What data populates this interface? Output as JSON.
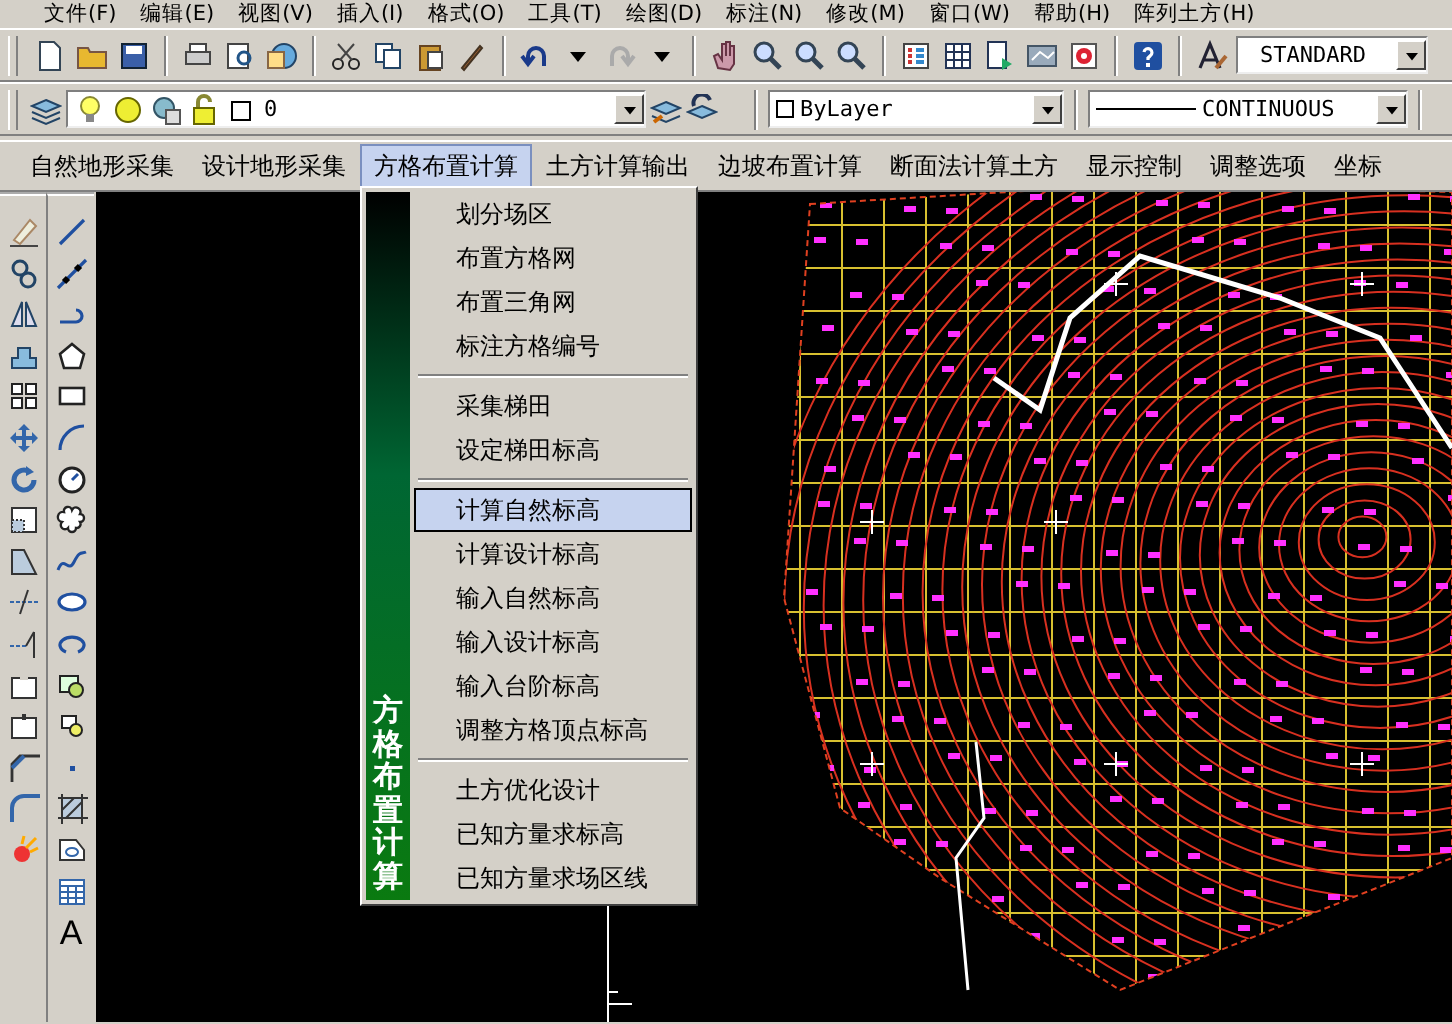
{
  "menu_bar": [
    "文件(F)",
    "编辑(E)",
    "视图(V)",
    "插入(I)",
    "格式(O)",
    "工具(T)",
    "绘图(D)",
    "标注(N)",
    "修改(M)",
    "窗口(W)",
    "帮助(H)",
    "阵列土方(H)"
  ],
  "standard_toolbar": {
    "text_style": "STANDARD"
  },
  "layers_toolbar": {
    "layer": "0"
  },
  "properties_toolbar": {
    "object_color": "ByLayer",
    "linetype": "CONTINUOUS"
  },
  "custom_menu": [
    {
      "label": "自然地形采集",
      "selected": false
    },
    {
      "label": "设计地形采集",
      "selected": false
    },
    {
      "label": "方格布置计算",
      "selected": true
    },
    {
      "label": "土方计算输出",
      "selected": false
    },
    {
      "label": "边坡布置计算",
      "selected": false
    },
    {
      "label": "断面法计算土方",
      "selected": false
    },
    {
      "label": "显示控制",
      "selected": false
    },
    {
      "label": "调整选项",
      "selected": false
    },
    {
      "label": "坐标",
      "selected": false
    }
  ],
  "dropdown": {
    "title": "方格布置计算",
    "groups": [
      [
        {
          "label": "划分场区",
          "selected": false
        },
        {
          "label": "布置方格网",
          "selected": false
        },
        {
          "label": "布置三角网",
          "selected": false
        },
        {
          "label": "标注方格编号",
          "selected": false
        }
      ],
      [
        {
          "label": "采集梯田",
          "selected": false
        },
        {
          "label": "设定梯田标高",
          "selected": false
        }
      ],
      [
        {
          "label": "计算自然标高",
          "selected": true
        },
        {
          "label": "计算设计标高",
          "selected": false
        },
        {
          "label": "输入自然标高",
          "selected": false
        },
        {
          "label": "输入设计标高",
          "selected": false
        },
        {
          "label": "输入台阶标高",
          "selected": false
        },
        {
          "label": "调整方格顶点标高",
          "selected": false
        }
      ],
      [
        {
          "label": "土方优化设计",
          "selected": false
        },
        {
          "label": "已知方量求标高",
          "selected": false
        },
        {
          "label": "已知方量求场区线",
          "selected": false
        }
      ]
    ]
  },
  "draw_toolbar": {
    "text_tool": "A"
  }
}
